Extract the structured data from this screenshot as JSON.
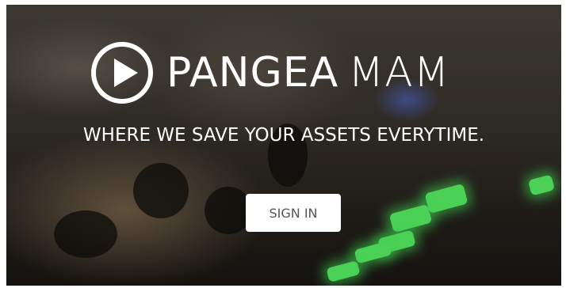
{
  "brand": {
    "icon": "play-circle-icon",
    "word1": "PANGEA",
    "word2": "MAM"
  },
  "hero": {
    "tagline": "WHERE WE SAVE YOUR ASSETS EVERYTIME."
  },
  "actions": {
    "sign_in_label": "SIGN IN"
  },
  "colors": {
    "text": "#ffffff",
    "button_bg": "#ffffff",
    "button_text": "#555555",
    "led_green": "#5cff6a"
  }
}
